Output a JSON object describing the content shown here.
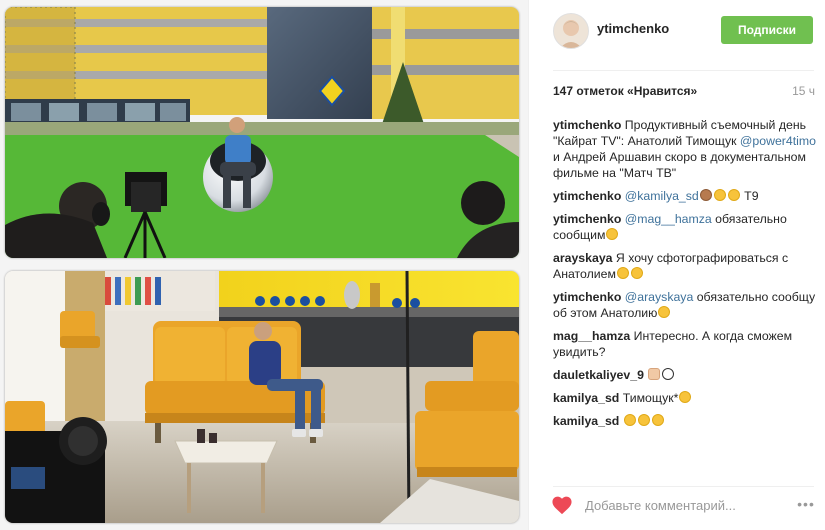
{
  "post": {
    "username": "ytimchenko",
    "follow_label": "Подписки",
    "likes": "147 отметок «Нравится»",
    "time": "15 ч"
  },
  "comments": [
    {
      "user": "ytimchenko",
      "segments": [
        {
          "type": "text",
          "value": "Продуктивный съемочный день \"Кайрат TV\": Анатолий  Тимощук "
        },
        {
          "type": "mention",
          "value": "@power4timo"
        },
        {
          "type": "text",
          "value": " и Андрей Аршавин скоро в документальном фильме на \"Матч ТВ\""
        }
      ]
    },
    {
      "user": "ytimchenko",
      "segments": [
        {
          "type": "mention",
          "value": "@kamilya_sd"
        },
        {
          "type": "emoji",
          "value": "monkey-emoji"
        },
        {
          "type": "emoji",
          "value": "laugh-emoji"
        },
        {
          "type": "emoji",
          "value": "laugh-emoji"
        },
        {
          "type": "text",
          "value": " Т9"
        }
      ]
    },
    {
      "user": "ytimchenko",
      "segments": [
        {
          "type": "mention",
          "value": "@mag__hamza"
        },
        {
          "type": "text",
          "value": " обязательно сообщим"
        },
        {
          "type": "emoji",
          "value": "smile-emoji"
        }
      ]
    },
    {
      "user": "arayskaya",
      "segments": [
        {
          "type": "text",
          "value": " Я хочу сфотографироваться с Анатолием"
        },
        {
          "type": "emoji",
          "value": "smile-emoji"
        },
        {
          "type": "emoji",
          "value": "smile-emoji"
        }
      ]
    },
    {
      "user": "ytimchenko",
      "segments": [
        {
          "type": "mention",
          "value": "@arayskaya"
        },
        {
          "type": "text",
          "value": " обязательно сообщу об этом Анатолию"
        },
        {
          "type": "emoji",
          "value": "laugh-emoji"
        }
      ]
    },
    {
      "user": "mag__hamza",
      "segments": [
        {
          "type": "text",
          "value": " Интересно. А когда сможем увидить?"
        }
      ]
    },
    {
      "user": "dauletkaliyev_9",
      "segments": [
        {
          "type": "emoji",
          "value": "hand-emoji"
        },
        {
          "type": "emoji",
          "value": "soccer-ball-emoji"
        }
      ]
    },
    {
      "user": "kamilya_sd",
      "segments": [
        {
          "type": "text",
          "value": " Тимощук*"
        },
        {
          "type": "emoji",
          "value": "laugh-emoji"
        }
      ]
    },
    {
      "user": "kamilya_sd",
      "segments": [
        {
          "type": "emoji",
          "value": "laugh-emoji"
        },
        {
          "type": "emoji",
          "value": "laugh-emoji"
        },
        {
          "type": "emoji",
          "value": "smile-emoji"
        }
      ]
    }
  ],
  "footer": {
    "placeholder": "Добавьте комментарий...",
    "more": "•••"
  },
  "icons": {
    "heart": "heart-icon",
    "more": "more-options-icon"
  },
  "colors": {
    "follow_button": "#70c050",
    "mention": "#3f729b",
    "heart": "#ed4956",
    "muted_text": "#999999"
  }
}
